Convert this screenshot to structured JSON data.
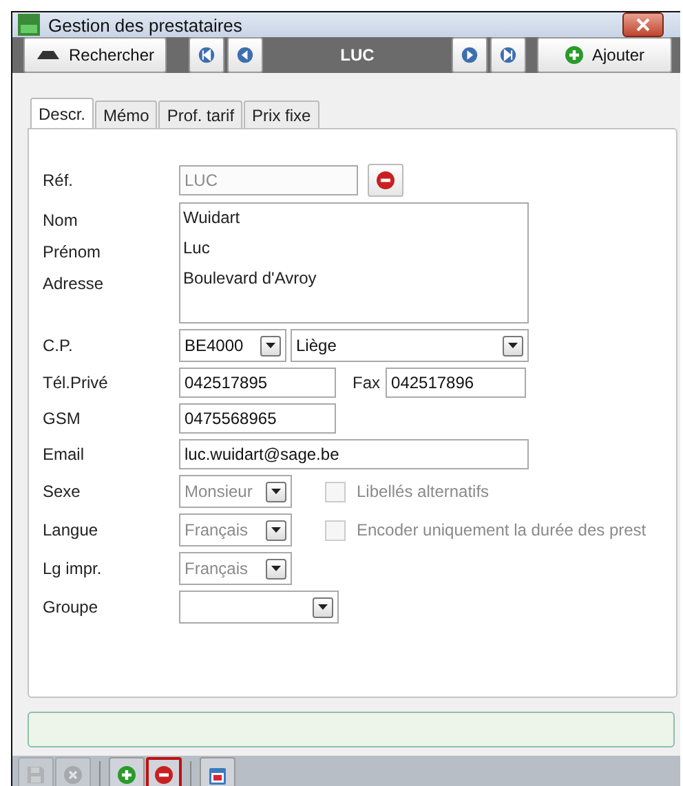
{
  "window": {
    "title": "Gestion des prestataires"
  },
  "toolbar": {
    "search_button": "Rechercher",
    "record": "LUC",
    "add_button": "Ajouter"
  },
  "tabs": [
    {
      "label": "Descr.",
      "selected": true
    },
    {
      "label": "Mémo",
      "selected": false
    },
    {
      "label": "Prof. tarif",
      "selected": false
    },
    {
      "label": "Prix fixe",
      "selected": false
    }
  ],
  "form": {
    "ref": {
      "label": "Réf.",
      "value": "LUC",
      "disabled": true
    },
    "identity": {
      "labels": [
        "Nom",
        "Prénom",
        "Adresse"
      ],
      "lines": [
        "Wuidart",
        "Luc",
        "Boulevard d'Avroy"
      ]
    },
    "cp": {
      "label": "C.P.",
      "code": "BE4000",
      "city": "Liège"
    },
    "phone": {
      "label": "Tél.Privé",
      "value": "042517895",
      "fax_label": "Fax",
      "fax": "042517896"
    },
    "gsm": {
      "label": "GSM",
      "value": "0475568965"
    },
    "email": {
      "label": "Email",
      "value": "luc.wuidart@sage.be"
    },
    "selects": [
      {
        "label": "Sexe",
        "value": "Monsieur",
        "disabled": true,
        "checkbox": {
          "label": "Libellés alternatifs",
          "checked": false,
          "disabled": true
        }
      },
      {
        "label": "Langue",
        "value": "Français",
        "disabled": true,
        "checkbox": {
          "label": "Encoder uniquement la durée des prest",
          "checked": false,
          "disabled": true
        }
      },
      {
        "label": "Lg impr.",
        "value": "Français",
        "disabled": true
      }
    ],
    "groupe": {
      "label": "Groupe"
    }
  },
  "bottom_toolbar": [
    {
      "kind": "save",
      "disabled": true,
      "selected": false
    },
    {
      "kind": "cancel",
      "disabled": true,
      "selected": false
    },
    {
      "kind": "add",
      "disabled": false,
      "selected": false
    },
    {
      "kind": "delete",
      "disabled": false,
      "selected": true
    },
    {
      "kind": "calendar",
      "disabled": false,
      "selected": false
    }
  ]
}
